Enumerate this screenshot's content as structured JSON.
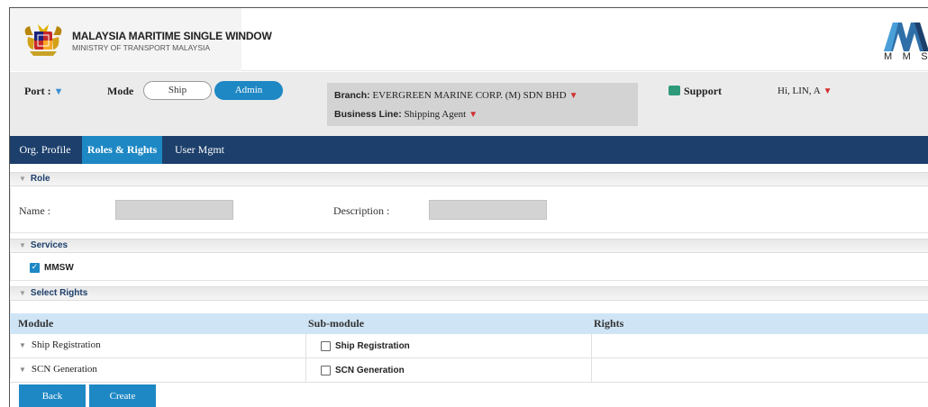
{
  "header": {
    "title": "MALAYSIA MARITIME SINGLE WINDOW",
    "subtitle": "MINISTRY OF TRANSPORT MALAYSIA",
    "logo_text": "MMSW",
    "logo_caption": "M M S W"
  },
  "controls": {
    "port_label": "Port :",
    "mode_label": "Mode",
    "mode_options": [
      "Ship",
      "Admin"
    ],
    "mode_selected": "Admin",
    "branch_label": "Branch:",
    "branch_value": "EVERGREEN MARINE CORP. (M) SDN BHD",
    "business_line_label": "Business Line:",
    "business_line_value": "Shipping Agent",
    "support_label": "Support",
    "user_greeting": "Hi, LIN, A"
  },
  "nav": {
    "tabs": [
      "Org. Profile",
      "Roles & Rights",
      "User Mgmt"
    ],
    "active": "Roles & Rights"
  },
  "role": {
    "section_title": "Role",
    "name_label": "Name :",
    "name_value": "",
    "description_label": "Description :",
    "description_value": ""
  },
  "services": {
    "section_title": "Services",
    "items": [
      {
        "label": "MMSW",
        "checked": true
      }
    ]
  },
  "rights": {
    "section_title": "Select Rights",
    "columns": [
      "Module",
      "Sub-module",
      "Rights"
    ],
    "rows": [
      {
        "module": "Ship Registration",
        "submodule": "Ship Registration",
        "checked": false,
        "rights": ""
      },
      {
        "module": "SCN Generation",
        "submodule": "SCN Generation",
        "checked": false,
        "rights": ""
      }
    ]
  },
  "actions": {
    "back_label": "Back",
    "create_label": "Create"
  },
  "colors": {
    "nav_bg": "#1c3f6b",
    "accent": "#1e88c4",
    "table_header": "#cfe5f6",
    "caret_red": "#d32f2f"
  }
}
